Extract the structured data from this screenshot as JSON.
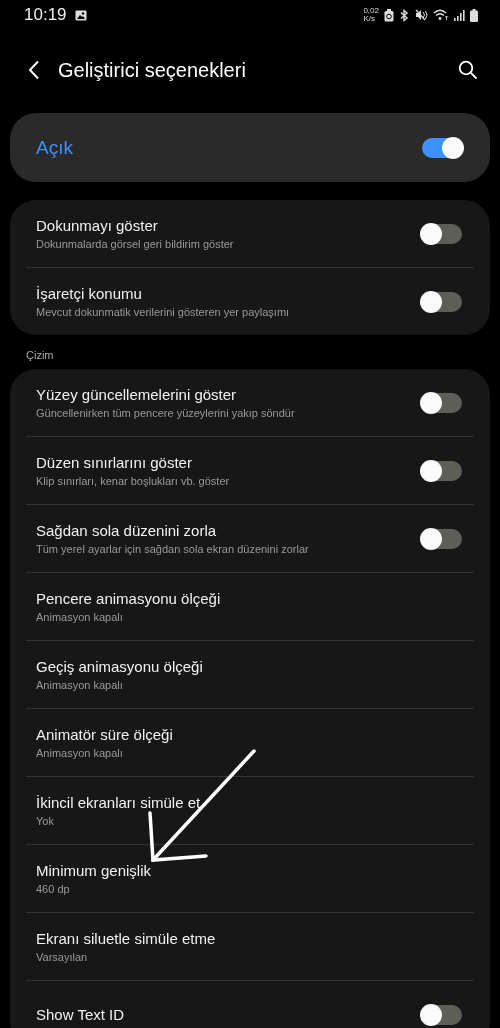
{
  "status_bar": {
    "time": "10:19",
    "net_speed": "0,02",
    "net_unit": "K/s"
  },
  "header": {
    "title": "Geliştirici seçenekleri"
  },
  "master": {
    "label": "Açık",
    "on": true
  },
  "groups": [
    {
      "rows": [
        {
          "kind": "toggle",
          "title": "Dokunmayı göster",
          "subtitle": "Dokunmalarda görsel geri bildirim göster",
          "on": false
        },
        {
          "kind": "toggle",
          "title": "İşaretçi konumu",
          "subtitle": "Mevcut dokunmatik verilerini gösteren yer paylaşımı",
          "on": false
        }
      ]
    },
    {
      "title": "Çizim",
      "rows": [
        {
          "kind": "toggle",
          "title": "Yüzey güncellemelerini göster",
          "subtitle": "Güncellenirken tüm pencere yüzeylerini yakıp söndür",
          "on": false
        },
        {
          "kind": "toggle",
          "title": "Düzen sınırlarını göster",
          "subtitle": "Klip sınırları, kenar boşlukları vb. göster",
          "on": false
        },
        {
          "kind": "toggle",
          "title": "Sağdan sola düzenini zorla",
          "subtitle": "Tüm yerel ayarlar için sağdan sola ekran düzenini zorlar",
          "on": false
        },
        {
          "kind": "value",
          "title": "Pencere animasyonu ölçeği",
          "subtitle": "Animasyon kapalı"
        },
        {
          "kind": "value",
          "title": "Geçiş animasyonu ölçeği",
          "subtitle": "Animasyon kapalı"
        },
        {
          "kind": "value",
          "title": "Animatör süre ölçeği",
          "subtitle": "Animasyon kapalı"
        },
        {
          "kind": "value",
          "title": "İkincil ekranları simüle et",
          "subtitle": "Yok"
        },
        {
          "kind": "value",
          "title": "Minimum genişlik",
          "subtitle": "460 dp"
        },
        {
          "kind": "value",
          "title": "Ekranı siluetle simüle etme",
          "subtitle": "Varsayılan"
        },
        {
          "kind": "toggle",
          "title": "Show Text ID",
          "on": false
        }
      ]
    }
  ]
}
